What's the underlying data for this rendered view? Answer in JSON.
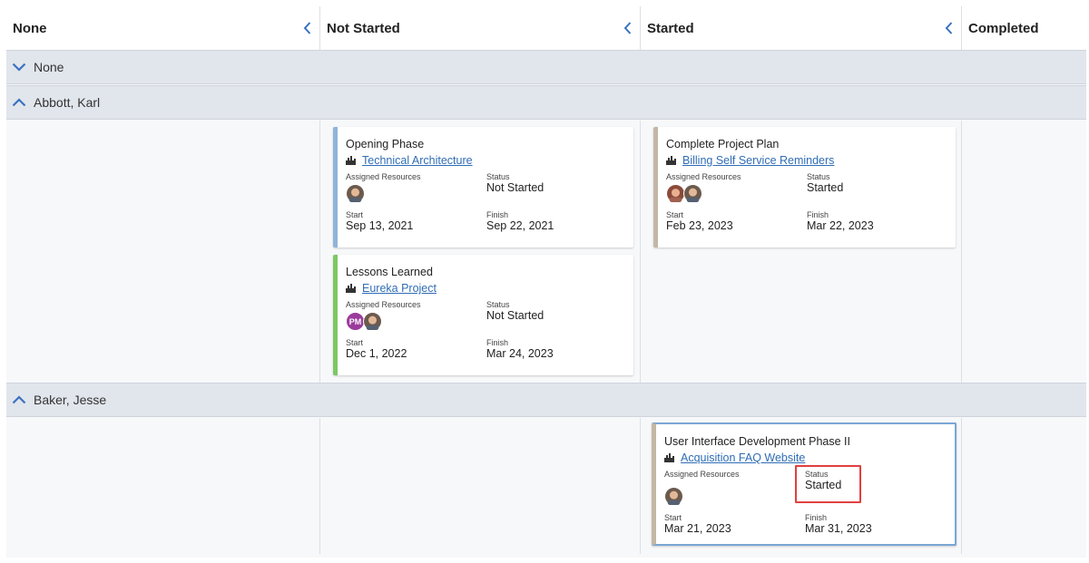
{
  "columns": [
    {
      "label": "None"
    },
    {
      "label": "Not Started"
    },
    {
      "label": "Started"
    },
    {
      "label": "Completed"
    }
  ],
  "lanes": [
    {
      "label": "None",
      "expanded": false
    },
    {
      "label": "Abbott, Karl",
      "expanded": true
    },
    {
      "label": "Baker, Jesse",
      "expanded": true
    }
  ],
  "field_labels": {
    "assigned": "Assigned Resources",
    "status": "Status",
    "start": "Start",
    "finish": "Finish"
  },
  "cards": [
    {
      "title": "Opening Phase",
      "project": "Technical Architecture",
      "status": "Not Started",
      "start": "Sep 13, 2021",
      "finish": "Sep 22, 2021",
      "accent": "#8fb4d9"
    },
    {
      "title": "Lessons Learned",
      "project": "Eureka Project",
      "status": "Not Started",
      "start": "Dec 1, 2022",
      "finish": "Mar 24, 2023",
      "accent": "#7cc864",
      "avatar_initials": "PM"
    },
    {
      "title": "Complete Project Plan",
      "project": "Billing Self Service Reminders",
      "status": "Started",
      "start": "Feb 23, 2023",
      "finish": "Mar 22, 2023",
      "accent": "#c3b7a5"
    },
    {
      "title": "User Interface Development Phase II",
      "project": "Acquisition FAQ Website",
      "status": "Started",
      "start": "Mar 21, 2023",
      "finish": "Mar 31, 2023",
      "accent": "#c3b7a5"
    }
  ],
  "colors": {
    "link": "#2f6db5",
    "lane_header": "#e1e5ec",
    "highlight": "#e04040",
    "selected_border": "#7aa6d6"
  },
  "icons": {
    "collapse": "chevron-left-icon",
    "lane_collapsed": "chevron-down-icon",
    "lane_expanded": "chevron-up-icon",
    "project": "project-icon",
    "avatar": "user-avatar-icon"
  }
}
